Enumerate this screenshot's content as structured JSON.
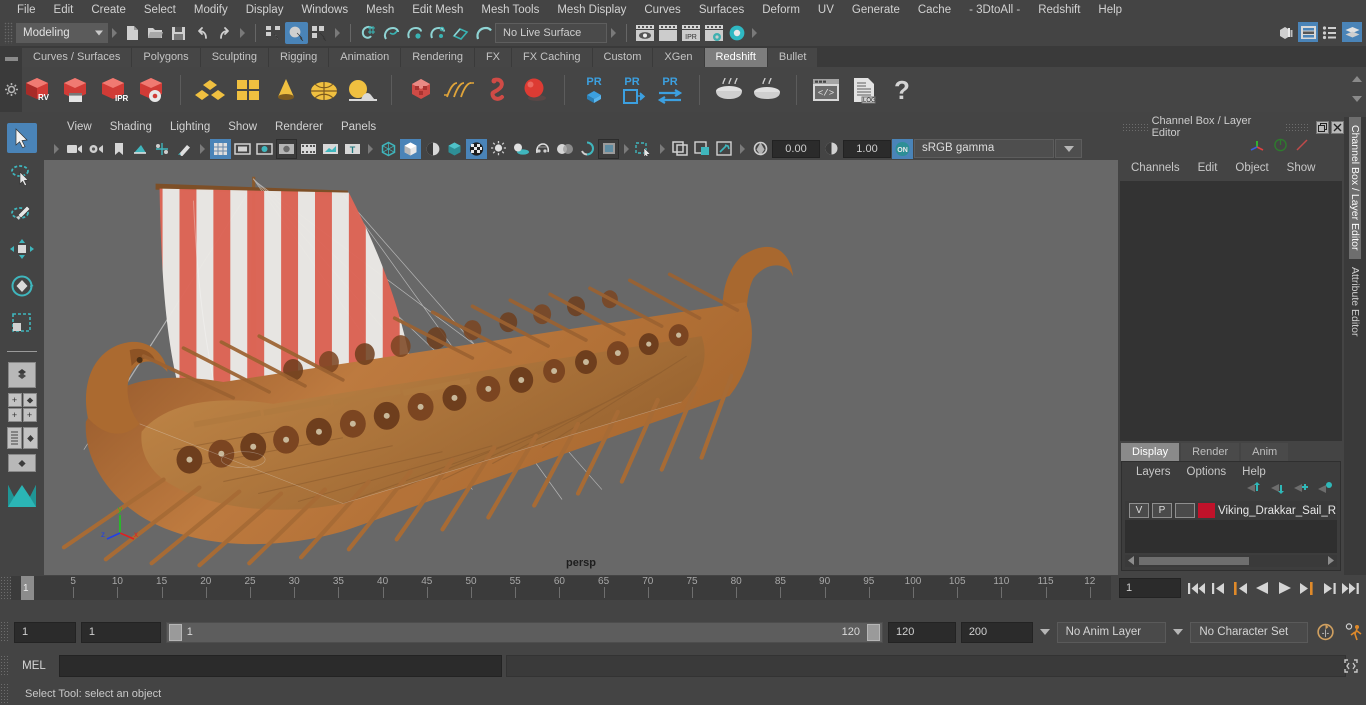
{
  "app": {
    "menus": [
      "File",
      "Edit",
      "Create",
      "Select",
      "Modify",
      "Display",
      "Windows",
      "Mesh",
      "Edit Mesh",
      "Mesh Tools",
      "Mesh Display",
      "Curves",
      "Surfaces",
      "Deform",
      "UV",
      "Generate",
      "Cache",
      "- 3DtoAll -",
      "Redshift",
      "Help"
    ]
  },
  "statusline": {
    "mode": "Modeling",
    "live_surface": "No Live Surface",
    "icons": [
      "new-scene-icon",
      "open-scene-icon",
      "save-scene-icon",
      "undo-icon",
      "redo-icon",
      "select-hierarchy-icon",
      "select-object-icon",
      "select-component-icon",
      "snap-grid-icon",
      "snap-curve-icon",
      "snap-point-icon",
      "snap-projected-center-icon",
      "snap-view-plane-icon",
      "make-live-icon",
      "show-render-view-icon",
      "render-current-frame-icon",
      "ipr-render-icon",
      "render-settings-icon",
      "hypershade-icon"
    ],
    "right_icons": [
      "modeling-toolkit-icon",
      "attribute-editor-icon",
      "tool-settings-icon",
      "channel-box-icon"
    ]
  },
  "shelf": {
    "tabs": [
      "Curves / Surfaces",
      "Polygons",
      "Sculpting",
      "Rigging",
      "Animation",
      "Rendering",
      "FX",
      "FX Caching",
      "Custom",
      "XGen",
      "Redshift",
      "Bullet"
    ],
    "selected_tab": "Redshift",
    "buttons": [
      "redshift-rv-icon",
      "redshift-render-sequence-icon",
      "redshift-ipr-icon",
      "redshift-render-settings-icon",
      "redshift-proxy-icon",
      "redshift-matte-icon",
      "redshift-light-cone-icon",
      "redshift-dome-light-icon",
      "redshift-environment-icon",
      "redshift-sprite-icon",
      "redshift-hair-icon",
      "redshift-volume-icon",
      "redshift-sphere-icon",
      "pr-bake-icon",
      "pr-export-icon",
      "pr-transfer-icon",
      "bake-set-icon",
      "bake-set-2-icon",
      "script-editor-icon",
      "log-file-icon",
      "help-icon"
    ]
  },
  "toolbox": {
    "tools": [
      "select-tool",
      "lasso-select-tool",
      "paint-select-tool",
      "move-tool",
      "rotate-tool",
      "scale-tool"
    ],
    "selected": "select-tool",
    "layouts": [
      "single-pane-layout",
      "four-pane-layout",
      "outliner-persp-layout",
      "hypergraph-persp-layout"
    ]
  },
  "viewport": {
    "menus": [
      "View",
      "Shading",
      "Lighting",
      "Show",
      "Renderer",
      "Panels"
    ],
    "toolbar_icons": [
      "select-camera-icon",
      "camera-attributes-icon",
      "bookmark-icon",
      "image-plane-icon",
      "two-d-pan-zoom-icon",
      "grease-pencil-icon",
      "grid-toggle-icon",
      "film-gate-icon",
      "resolution-gate-icon",
      "gate-mask-icon",
      "film-origin-icon",
      "exposure-icon",
      "hud-toggle-icon",
      "wireframe-icon",
      "smooth-shade-icon",
      "smooth-shade-highlight-icon",
      "flat-shade-icon",
      "textured-icon",
      "use-lights-icon",
      "shadows-icon",
      "screen-space-ao-icon",
      "motion-blur-icon",
      "multisample-icon",
      "depth-of-field-icon",
      "isolate-select-icon",
      "xray-icon",
      "xray-joints-icon",
      "xray-active-components-icon"
    ],
    "exposure": "0.00",
    "gamma": "1.00",
    "view_transform": "sRGB gamma",
    "camera_label": "persp",
    "axis_labels": {
      "x": "x",
      "y": "y",
      "z": "z"
    }
  },
  "channel_box": {
    "title": "Channel Box / Layer Editor",
    "menus": [
      "Channels",
      "Edit",
      "Object",
      "Show"
    ],
    "window_buttons": [
      "restore-window-icon",
      "close-window-icon"
    ],
    "side_tabs": [
      "Channel Box / Layer Editor",
      "Attribute Editor"
    ],
    "selected_side_tab": "Channel Box / Layer Editor"
  },
  "layer_editor": {
    "tabs": [
      "Display",
      "Render",
      "Anim"
    ],
    "selected_tab": "Display",
    "menus": [
      "Layers",
      "Options",
      "Help"
    ],
    "buttons": [
      "move-layer-up-icon",
      "move-layer-down-icon",
      "new-layer-icon",
      "new-layer-from-selected-icon"
    ],
    "layers": [
      {
        "visibility": "V",
        "playback": "P",
        "shading": "",
        "color": "#c0122a",
        "name": "Viking_Drakkar_Sail_R"
      }
    ]
  },
  "time_slider": {
    "current_frame": "1",
    "frame_field": "1",
    "tick_labels": [
      "5",
      "10",
      "15",
      "20",
      "25",
      "30",
      "35",
      "40",
      "45",
      "50",
      "55",
      "60",
      "65",
      "70",
      "75",
      "80",
      "85",
      "90",
      "95",
      "100",
      "105",
      "110",
      "115",
      "12"
    ],
    "playback_buttons": [
      "go-to-start-icon",
      "step-back-keyframe-icon",
      "step-back-frame-icon",
      "play-backwards-icon",
      "play-forwards-icon",
      "step-forward-frame-icon",
      "step-forward-keyframe-icon",
      "go-to-end-icon"
    ]
  },
  "range_slider": {
    "anim_start": "1",
    "range_start": "1",
    "range_track_start": "1",
    "range_track_end": "120",
    "range_end": "120",
    "anim_end": "200",
    "anim_layer": "No Anim Layer",
    "character_set": "No Character Set",
    "right_icons": [
      "auto-key-icon",
      "animation-preferences-icon"
    ]
  },
  "command_line": {
    "label": "MEL",
    "input_value": "",
    "output_value": "",
    "script-editor-icon": "script-editor-icon"
  },
  "status_bar": {
    "help_text": "Select Tool: select an object"
  },
  "colors": {
    "accent_blue": "#4a84b8",
    "layer_red": "#c0122a",
    "viewport_bg": "#686868",
    "sail_red": "#d9503f",
    "hull_wood": "#b06a33"
  }
}
